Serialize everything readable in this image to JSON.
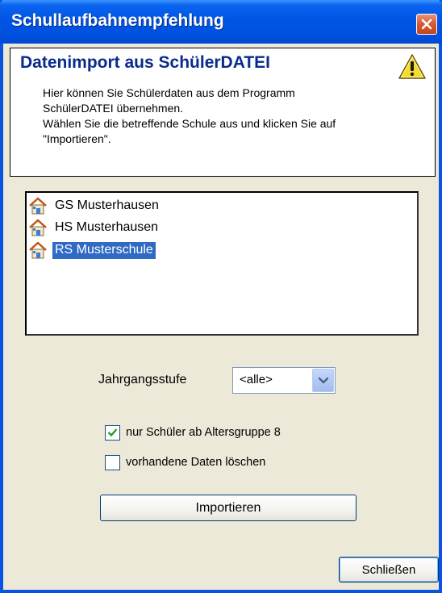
{
  "window": {
    "title": "Schullaufbahnempfehlung",
    "colors": {
      "titlebar": "#0055E5",
      "face": "#ECE9D8",
      "selection": "#316AC5",
      "heading": "#0A2B8C"
    }
  },
  "header": {
    "title": "Datenimport aus SchülerDATEI",
    "icon": "warning-icon",
    "description": [
      "Hier können Sie Schülerdaten aus dem Programm",
      "SchülerDATEI übernehmen.",
      "Wählen Sie die betreffende Schule aus und klicken Sie auf",
      "\"Importieren\"."
    ]
  },
  "school_list": {
    "item_icon": "school-house-icon",
    "items": [
      {
        "label": "GS Musterhausen",
        "selected": false
      },
      {
        "label": "HS Musterhausen",
        "selected": false
      },
      {
        "label": "RS Musterschule",
        "selected": true
      }
    ]
  },
  "jahrgangsstufe": {
    "label": "Jahrgangsstufe",
    "selected_value": "<alle>"
  },
  "options": {
    "age_group": {
      "label": "nur Schüler ab Altersgruppe 8",
      "checked": true
    },
    "delete_existing": {
      "label": "vorhandene Daten löschen",
      "checked": false
    }
  },
  "buttons": {
    "import_label": "Importieren",
    "close_label": "Schließen"
  }
}
